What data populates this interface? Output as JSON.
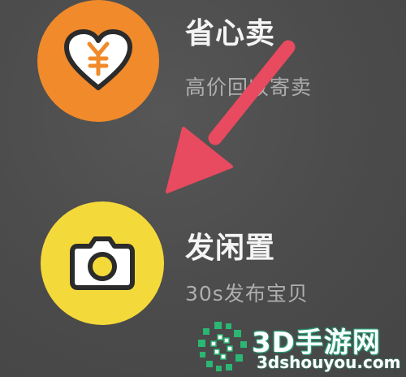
{
  "menu": {
    "items": [
      {
        "title": "省心卖",
        "subtitle": "高价回收寄卖",
        "icon": "heart-yen-icon",
        "color": "#f08a2a"
      },
      {
        "title": "发闲置",
        "subtitle": "30s发布宝贝",
        "icon": "camera-icon",
        "color": "#f4d93a"
      }
    ]
  },
  "annotation": {
    "icon": "red-arrow-icon",
    "color": "#e84a5f"
  },
  "watermark": {
    "brand": "3D手游网",
    "domain": "3dshouyou.com"
  }
}
